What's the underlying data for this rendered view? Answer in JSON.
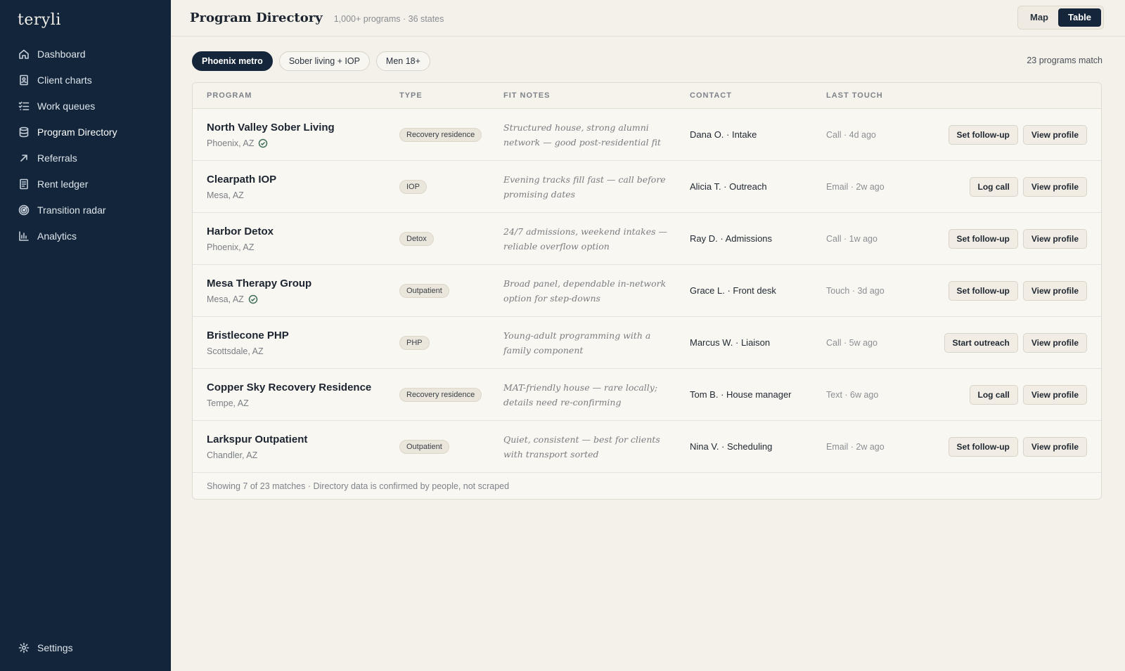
{
  "app": {
    "brand": "teryli"
  },
  "sidebar": {
    "items": [
      {
        "label": "Dashboard",
        "icon": "home-icon"
      },
      {
        "label": "Client charts",
        "icon": "client-chart-icon"
      },
      {
        "label": "Work queues",
        "icon": "checklist-icon"
      },
      {
        "label": "Program Directory",
        "icon": "database-icon",
        "active": true
      },
      {
        "label": "Referrals",
        "icon": "arrow-up-right-icon"
      },
      {
        "label": "Rent ledger",
        "icon": "ledger-icon"
      },
      {
        "label": "Transition radar",
        "icon": "radar-icon"
      },
      {
        "label": "Analytics",
        "icon": "bar-chart-icon"
      }
    ],
    "settings_label": "Settings"
  },
  "header": {
    "title": "Program Directory",
    "subtitle": "1,000+ programs · 36 states",
    "view_toggle": {
      "map": "Map",
      "table": "Table",
      "selected": "Table"
    }
  },
  "filters": {
    "chips": [
      "Phoenix metro",
      "Sober living + IOP",
      "Men 18+"
    ],
    "active_chip": "Phoenix metro",
    "match_count": "23 programs match"
  },
  "table": {
    "columns": [
      "PROGRAM",
      "TYPE",
      "FIT NOTES",
      "CONTACT",
      "LAST TOUCH"
    ],
    "rows": [
      {
        "name": "North Valley Sober Living",
        "location": "Phoenix, AZ",
        "verified": true,
        "type": "Recovery residence",
        "fit": "Structured house, strong alumni network — good post-residential fit",
        "contact": "Dana O. · Intake",
        "last_touch": "Call · 4d ago",
        "action": "Set follow-up",
        "profile": "View profile"
      },
      {
        "name": "Clearpath IOP",
        "location": "Mesa, AZ",
        "verified": false,
        "type": "IOP",
        "fit": "Evening tracks fill fast — call before promising dates",
        "contact": "Alicia T. · Outreach",
        "last_touch": "Email · 2w ago",
        "action": "Log call",
        "profile": "View profile"
      },
      {
        "name": "Harbor Detox",
        "location": "Phoenix, AZ",
        "verified": false,
        "type": "Detox",
        "fit": "24/7 admissions, weekend intakes — reliable overflow option",
        "contact": "Ray D. · Admissions",
        "last_touch": "Call · 1w ago",
        "action": "Set follow-up",
        "profile": "View profile"
      },
      {
        "name": "Mesa Therapy Group",
        "location": "Mesa, AZ",
        "verified": true,
        "type": "Outpatient",
        "fit": "Broad panel, dependable in-network option for step-downs",
        "contact": "Grace L. · Front desk",
        "last_touch": "Touch · 3d ago",
        "action": "Set follow-up",
        "profile": "View profile"
      },
      {
        "name": "Bristlecone PHP",
        "location": "Scottsdale, AZ",
        "verified": false,
        "type": "PHP",
        "fit": "Young-adult programming with a family component",
        "contact": "Marcus W. · Liaison",
        "last_touch": "Call · 5w ago",
        "action": "Start outreach",
        "profile": "View profile"
      },
      {
        "name": "Copper Sky Recovery Residence",
        "location": "Tempe, AZ",
        "verified": false,
        "type": "Recovery residence",
        "fit": "MAT-friendly house — rare locally; details need re-confirming",
        "contact": "Tom B. · House manager",
        "last_touch": "Text · 6w ago",
        "action": "Log call",
        "profile": "View profile"
      },
      {
        "name": "Larkspur Outpatient",
        "location": "Chandler, AZ",
        "verified": false,
        "type": "Outpatient",
        "fit": "Quiet, consistent — best for clients with transport sorted",
        "contact": "Nina V. · Scheduling",
        "last_touch": "Email · 2w ago",
        "action": "Set follow-up",
        "profile": "View profile"
      }
    ],
    "footer": "Showing 7 of 23 matches · Directory data is confirmed by people, not scraped"
  },
  "colors": {
    "sidebar_bg": "#12253a",
    "page_bg": "#f4f1ea",
    "accent": "#16263a",
    "verified": "#3f6e58"
  }
}
